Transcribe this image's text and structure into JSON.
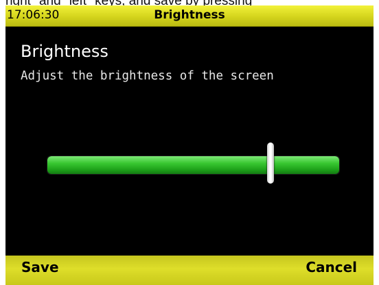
{
  "caption_fragment": "right\" and \"left\" keys, and save by pressing",
  "status_bar": {
    "time": "17:06:30",
    "title": "Brightness"
  },
  "content": {
    "heading": "Brightness",
    "description": "Adjust the brightness of the screen"
  },
  "brightness_slider": {
    "value_fraction": 0.765,
    "fill_color": "#38c731",
    "thumb_color": "#ffffff"
  },
  "softkeys": {
    "left_label": "Save",
    "right_label": "Cancel"
  },
  "colors": {
    "bar_yellow": "#dede2a",
    "background": "#000000",
    "text": "#ffffff"
  }
}
